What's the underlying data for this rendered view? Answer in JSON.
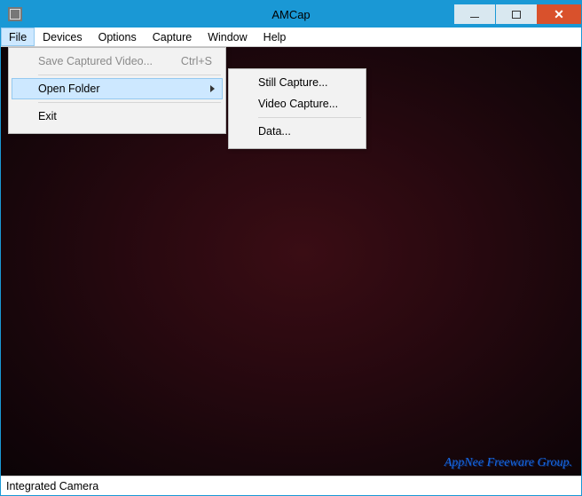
{
  "window": {
    "title": "AMCap"
  },
  "menubar": {
    "items": [
      "File",
      "Devices",
      "Options",
      "Capture",
      "Window",
      "Help"
    ],
    "open_index": 0
  },
  "file_menu": {
    "save_label": "Save Captured Video...",
    "save_accel": "Ctrl+S",
    "open_folder_label": "Open Folder",
    "exit_label": "Exit"
  },
  "open_folder_submenu": {
    "still_label": "Still Capture...",
    "video_label": "Video Capture...",
    "data_label": "Data..."
  },
  "statusbar": {
    "text": "Integrated Camera"
  },
  "watermark": "AppNee Freeware Group."
}
